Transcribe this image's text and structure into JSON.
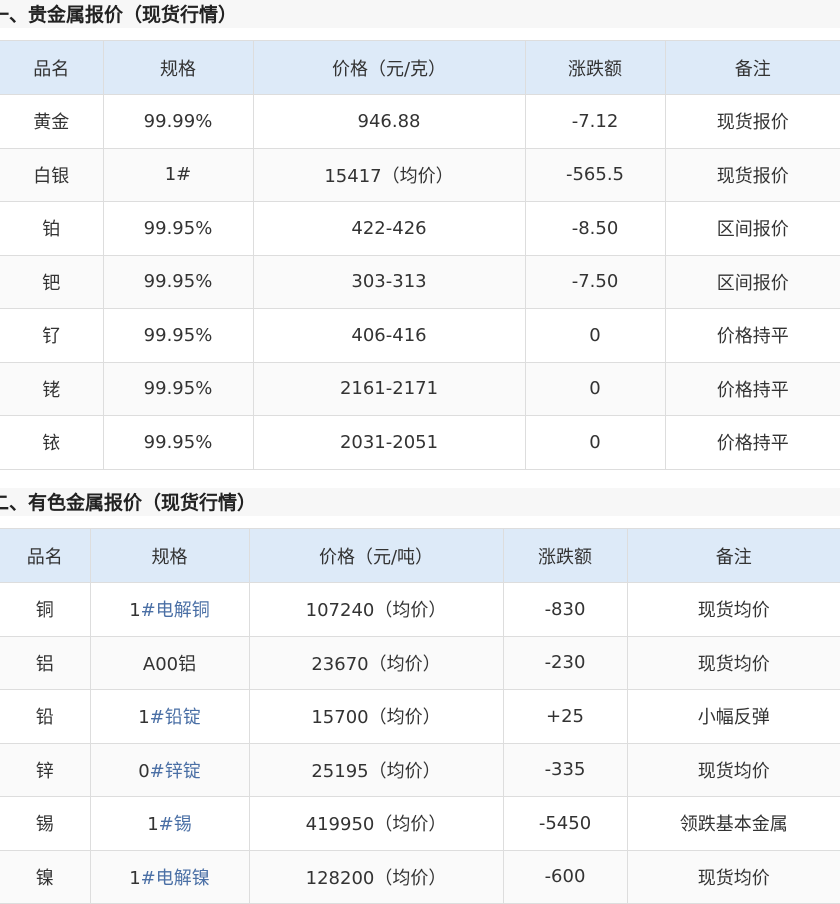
{
  "section1": {
    "title": "一、贵金属报价（现货行情）",
    "headers": [
      "品名",
      "规格",
      "价格（元/克）",
      "涨跌额",
      "备注"
    ],
    "rows": [
      {
        "name": "黄金",
        "spec": "99.99%",
        "price": "946.88",
        "change": "-7.12",
        "note": "现货报价"
      },
      {
        "name": "白银",
        "spec": "1#",
        "price": "15417（均价）",
        "change": "-565.5",
        "note": "现货报价"
      },
      {
        "name": "铂",
        "spec": "99.95%",
        "price": "422-426",
        "change": "-8.50",
        "note": "区间报价"
      },
      {
        "name": "钯",
        "spec": "99.95%",
        "price": "303-313",
        "change": "-7.50",
        "note": "区间报价"
      },
      {
        "name": "钌",
        "spec": "99.95%",
        "price": "406-416",
        "change": "0",
        "note": "价格持平"
      },
      {
        "name": "铑",
        "spec": "99.95%",
        "price": "2161-2171",
        "change": "0",
        "note": "价格持平"
      },
      {
        "name": "铱",
        "spec": "99.95%",
        "price": "2031-2051",
        "change": "0",
        "note": "价格持平"
      }
    ]
  },
  "section2": {
    "title": "二、有色金属报价（现货行情）",
    "headers": [
      "品名",
      "规格",
      "价格（元/吨）",
      "涨跌额",
      "备注"
    ],
    "rows": [
      {
        "name": "铜",
        "spec_prefix": "1",
        "spec_link": "#电解铜",
        "price": "107240（均价）",
        "change": "-830",
        "note": "现货均价"
      },
      {
        "name": "铝",
        "spec_prefix": "A00铝",
        "spec_link": "",
        "price": "23670（均价）",
        "change": "-230",
        "note": "现货均价"
      },
      {
        "name": "铅",
        "spec_prefix": "1",
        "spec_link": "#铅锭",
        "price": "15700（均价）",
        "change": "+25",
        "note": "小幅反弹"
      },
      {
        "name": "锌",
        "spec_prefix": "0",
        "spec_link": "#锌锭",
        "price": "25195（均价）",
        "change": "-335",
        "note": "现货均价"
      },
      {
        "name": "锡",
        "spec_prefix": "1",
        "spec_link": "#锡",
        "price": "419950（均价）",
        "change": "-5450",
        "note": "领跌基本金属"
      },
      {
        "name": "镍",
        "spec_prefix": "1",
        "spec_link": "#电解镍",
        "price": "128200（均价）",
        "change": "-600",
        "note": "现货均价"
      }
    ]
  }
}
